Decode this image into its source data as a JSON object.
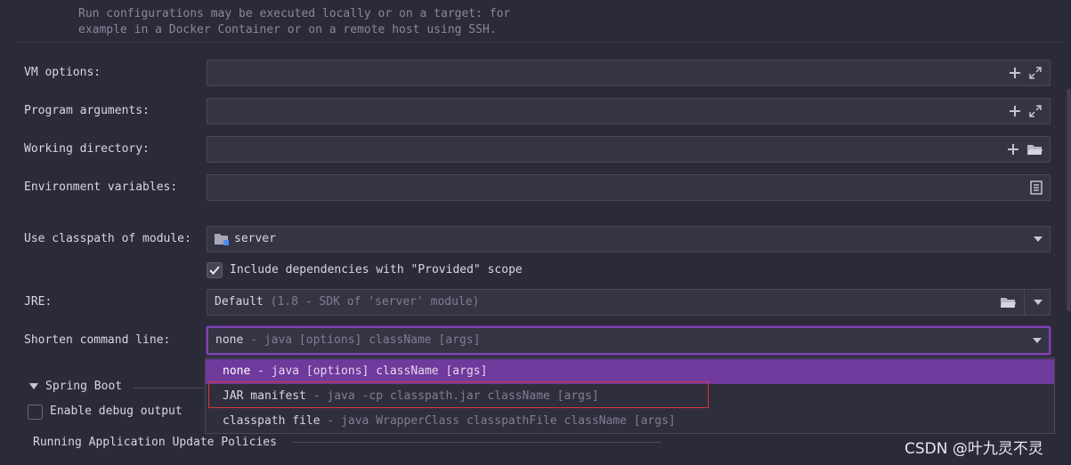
{
  "info_text": [
    "Run configurations may be executed locally or on a target: for",
    "example in a Docker Container or on a remote host using SSH."
  ],
  "vm_options": {
    "label": "VM options:",
    "value": ""
  },
  "program_arguments": {
    "label": "Program arguments:",
    "value": ""
  },
  "working_directory": {
    "label": "Working directory:",
    "value": ""
  },
  "environment_variables": {
    "label": "Environment variables:",
    "value": ""
  },
  "classpath_module": {
    "label": "Use classpath of module:",
    "value": "server"
  },
  "include_dependencies": {
    "label": "Include dependencies with \"Provided\" scope",
    "checked": true
  },
  "jre": {
    "label": "JRE:",
    "value": "Default",
    "detail": "(1.8 - SDK of 'server' module)"
  },
  "shorten_command_line": {
    "label": "Shorten command line:",
    "value": "none",
    "value_detail": "- java [options] className [args]",
    "options": [
      {
        "name": "none",
        "detail": "- java [options] className [args]",
        "selected": true
      },
      {
        "name": "JAR manifest",
        "detail": "- java -cp classpath.jar className [args]",
        "selected": false
      },
      {
        "name": "classpath file",
        "detail": "- java WrapperClass classpathFile className [args]",
        "selected": false
      }
    ]
  },
  "spring_boot": {
    "section_title": "Spring Boot",
    "debug_label": "Enable debug output",
    "debug_checked": false
  },
  "running_update_policies": {
    "label": "Running Application Update Policies"
  },
  "watermark": "CSDN @叶九灵不灵",
  "colors": {
    "background": "#2b2a38",
    "field": "#353443",
    "accent": "#6f3a9c",
    "highlight_box": "#d23a3a"
  }
}
